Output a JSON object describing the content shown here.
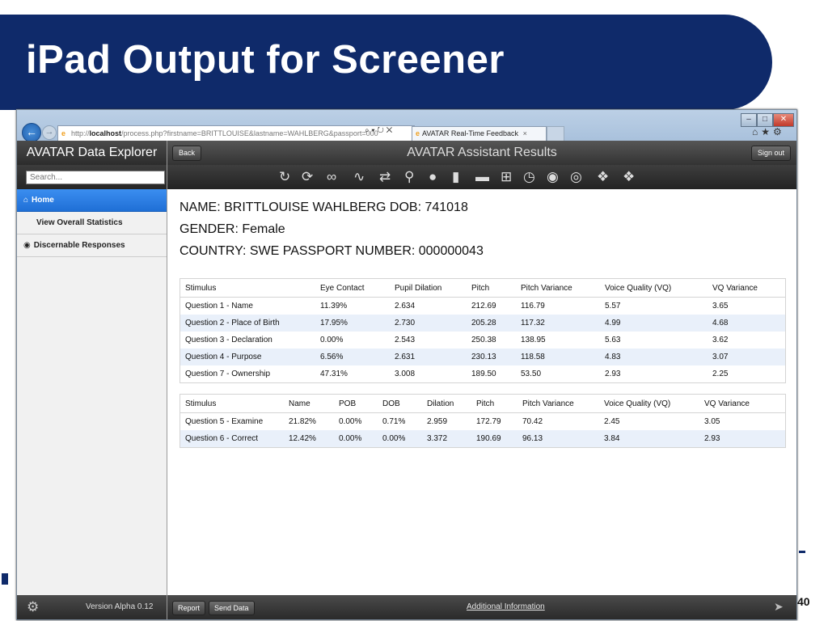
{
  "slide": {
    "title": "iPad Output for Screener",
    "page_number": "40"
  },
  "browser": {
    "url": "http://localhost/process.php?firstname=BRITTLOUISE&lastname=WAHLBERG&passport=000",
    "url_host": "localhost",
    "url_prefix": "http://",
    "url_rest": "/process.php?firstname=BRITTLOUISE&lastname=WAHLBERG&passport=000",
    "addr_controls": "⌕ ▾ ↻ ✕",
    "tab_label": "AVATAR Real-Time Feedback",
    "tab_close": "×",
    "icons": [
      "home-icon",
      "star-icon",
      "gear-icon"
    ]
  },
  "sidebar": {
    "title": "AVATAR Data Explorer",
    "search_placeholder": "Search...",
    "items": [
      {
        "label": "Home",
        "icon": "home-icon",
        "selected": true
      },
      {
        "label": "View Overall Statistics",
        "selected": false
      },
      {
        "label": "Discernable Responses",
        "icon": "circle-arrow-icon",
        "selected": false
      }
    ],
    "version": "Version Alpha 0.12"
  },
  "header": {
    "back_label": "Back",
    "title": "AVATAR Assistant Results",
    "signout_label": "Sign out"
  },
  "toolbar": {
    "icons": [
      "refresh-icon",
      "sync-icon",
      "link-icon",
      "waveform-icon",
      "shuffle-icon",
      "search-icon",
      "location-pin-icon",
      "chat-bubble-icon",
      "chat-bubbles-icon",
      "plus-square-icon",
      "clock-icon",
      "eye-icon",
      "target-icon",
      "tag-icon",
      "tags-icon"
    ]
  },
  "subject": {
    "line1": "NAME: BRITTLOUISE WAHLBERG DOB: 741018",
    "line2": "GENDER: Female",
    "line3": "COUNTRY: SWE PASSPORT NUMBER: 000000043"
  },
  "table1": {
    "headers": [
      "Stimulus",
      "Eye Contact",
      "Pupil Dilation",
      "Pitch",
      "Pitch Variance",
      "Voice Quality (VQ)",
      "VQ Variance"
    ],
    "rows": [
      [
        "Question 1 - Name",
        "11.39%",
        "2.634",
        "212.69",
        "116.79",
        "5.57",
        "3.65"
      ],
      [
        "Question 2 - Place of Birth",
        "17.95%",
        "2.730",
        "205.28",
        "117.32",
        "4.99",
        "4.68"
      ],
      [
        "Question 3 - Declaration",
        "0.00%",
        "2.543",
        "250.38",
        "138.95",
        "5.63",
        "3.62"
      ],
      [
        "Question 4 - Purpose",
        "6.56%",
        "2.631",
        "230.13",
        "118.58",
        "4.83",
        "3.07"
      ],
      [
        "Question 7 - Ownership",
        "47.31%",
        "3.008",
        "189.50",
        "53.50",
        "2.93",
        "2.25"
      ]
    ]
  },
  "table2": {
    "headers": [
      "Stimulus",
      "Name",
      "POB",
      "DOB",
      "Dilation",
      "Pitch",
      "Pitch Variance",
      "Voice Quality (VQ)",
      "VQ Variance"
    ],
    "rows": [
      [
        "Question 5 - Examine",
        "21.82%",
        "0.00%",
        "0.71%",
        "2.959",
        "172.79",
        "70.42",
        "2.45",
        "3.05"
      ],
      [
        "Question 6 - Correct",
        "12.42%",
        "0.00%",
        "0.00%",
        "3.372",
        "190.69",
        "96.13",
        "3.84",
        "2.93"
      ]
    ]
  },
  "footer": {
    "report_label": "Report",
    "send_label": "Send Data",
    "link_label": "Additional Information"
  },
  "colors": {
    "banner": "#0f2a6a",
    "selected_item": "#2b7de0",
    "alt_row": "#e9f0fa"
  }
}
